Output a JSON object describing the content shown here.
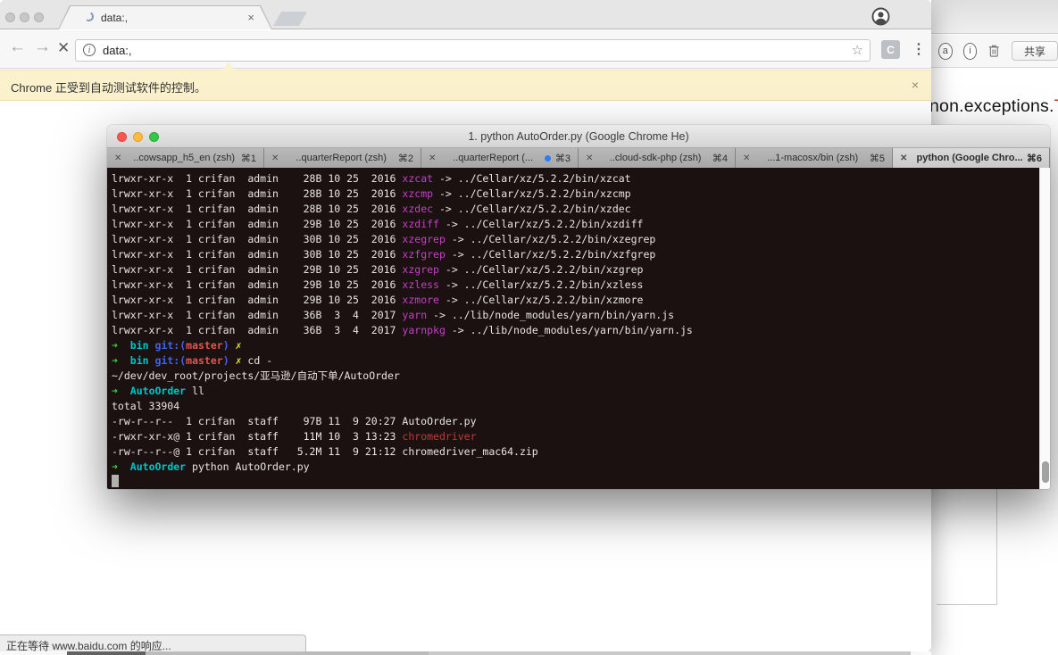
{
  "browser": {
    "tab_title": "data:,",
    "url": "data:,",
    "extension_label": "C",
    "infobar_text": "Chrome 正受到自动测试软件的控制。",
    "infobar_close": "×",
    "status_text": "正在等待 www.baidu.com 的响应...",
    "tab_close": "×",
    "back_glyph": "←",
    "forward_glyph": "→",
    "stop_glyph": "✕",
    "star_glyph": "☆",
    "menu_glyph": "⋮",
    "info_glyph": "i"
  },
  "background_window": {
    "share_button": "共享",
    "annotation_glyph": "a",
    "info_glyph": "i",
    "partial_text": "non.exceptions.",
    "partial_text_red": "Tr"
  },
  "terminal": {
    "title": "1. python AutoOrder.py (Google Chrome He)",
    "tab_close_glyph": "✕",
    "tabs": [
      {
        "label": "..cowsapp_h5_en (zsh)",
        "shortcut": "⌘1",
        "active": false,
        "dot": false
      },
      {
        "label": "..quarterReport (zsh)",
        "shortcut": "⌘2",
        "active": false,
        "dot": false
      },
      {
        "label": "..quarterReport (...",
        "shortcut": "⌘3",
        "active": false,
        "dot": true
      },
      {
        "label": "..cloud-sdk-php (zsh)",
        "shortcut": "⌘4",
        "active": false,
        "dot": false
      },
      {
        "label": "...1-macosx/bin (zsh)",
        "shortcut": "⌘5",
        "active": false,
        "dot": false
      },
      {
        "label": "python (Google Chro...",
        "shortcut": "⌘6",
        "active": true,
        "dot": false
      }
    ],
    "colors": {
      "background": "#1b1111",
      "foreground": "#e8e5e0",
      "symlink_magenta": "#c73fc7",
      "prompt_green": "#36d236",
      "prompt_cyan": "#00c5c7",
      "git_blue": "#4263f0",
      "branch_red": "#e05650",
      "file_red": "#c23936",
      "dirty_yellow": "#e7e735"
    },
    "lines": [
      [
        [
          "fg",
          "lrwxr-xr-x  1 crifan  admin    28B 10 25  2016 "
        ],
        [
          "ln",
          "xzcat"
        ],
        [
          "fg",
          " -> ../Cellar/xz/5.2.2/bin/xzcat"
        ]
      ],
      [
        [
          "fg",
          "lrwxr-xr-x  1 crifan  admin    28B 10 25  2016 "
        ],
        [
          "ln",
          "xzcmp"
        ],
        [
          "fg",
          " -> ../Cellar/xz/5.2.2/bin/xzcmp"
        ]
      ],
      [
        [
          "fg",
          "lrwxr-xr-x  1 crifan  admin    28B 10 25  2016 "
        ],
        [
          "ln",
          "xzdec"
        ],
        [
          "fg",
          " -> ../Cellar/xz/5.2.2/bin/xzdec"
        ]
      ],
      [
        [
          "fg",
          "lrwxr-xr-x  1 crifan  admin    29B 10 25  2016 "
        ],
        [
          "ln",
          "xzdiff"
        ],
        [
          "fg",
          " -> ../Cellar/xz/5.2.2/bin/xzdiff"
        ]
      ],
      [
        [
          "fg",
          "lrwxr-xr-x  1 crifan  admin    30B 10 25  2016 "
        ],
        [
          "ln",
          "xzegrep"
        ],
        [
          "fg",
          " -> ../Cellar/xz/5.2.2/bin/xzegrep"
        ]
      ],
      [
        [
          "fg",
          "lrwxr-xr-x  1 crifan  admin    30B 10 25  2016 "
        ],
        [
          "ln",
          "xzfgrep"
        ],
        [
          "fg",
          " -> ../Cellar/xz/5.2.2/bin/xzfgrep"
        ]
      ],
      [
        [
          "fg",
          "lrwxr-xr-x  1 crifan  admin    29B 10 25  2016 "
        ],
        [
          "ln",
          "xzgrep"
        ],
        [
          "fg",
          " -> ../Cellar/xz/5.2.2/bin/xzgrep"
        ]
      ],
      [
        [
          "fg",
          "lrwxr-xr-x  1 crifan  admin    29B 10 25  2016 "
        ],
        [
          "ln",
          "xzless"
        ],
        [
          "fg",
          " -> ../Cellar/xz/5.2.2/bin/xzless"
        ]
      ],
      [
        [
          "fg",
          "lrwxr-xr-x  1 crifan  admin    29B 10 25  2016 "
        ],
        [
          "ln",
          "xzmore"
        ],
        [
          "fg",
          " -> ../Cellar/xz/5.2.2/bin/xzmore"
        ]
      ],
      [
        [
          "fg",
          "lrwxr-xr-x  1 crifan  admin    36B  3  4  2017 "
        ],
        [
          "ln",
          "yarn"
        ],
        [
          "fg",
          " -> ../lib/node_modules/yarn/bin/yarn.js"
        ]
      ],
      [
        [
          "fg",
          "lrwxr-xr-x  1 crifan  admin    36B  3  4  2017 "
        ],
        [
          "ln",
          "yarnpkg"
        ],
        [
          "fg",
          " -> ../lib/node_modules/yarn/bin/yarn.js"
        ]
      ],
      [
        [
          "gr",
          "➜"
        ],
        [
          "fg",
          "  "
        ],
        [
          "cy",
          "bin"
        ],
        [
          "fg",
          " "
        ],
        [
          "bl",
          "git:("
        ],
        [
          "rd",
          "master"
        ],
        [
          "bl",
          ")"
        ],
        [
          "fg",
          " "
        ],
        [
          "yl",
          "✗"
        ]
      ],
      [
        [
          "gr",
          "➜"
        ],
        [
          "fg",
          "  "
        ],
        [
          "cy",
          "bin"
        ],
        [
          "fg",
          " "
        ],
        [
          "bl",
          "git:("
        ],
        [
          "rd",
          "master"
        ],
        [
          "bl",
          ")"
        ],
        [
          "fg",
          " "
        ],
        [
          "yl",
          "✗"
        ],
        [
          "fg",
          " cd -"
        ]
      ],
      [
        [
          "fg",
          "~/dev/dev_root/projects/亚马逊/自动下单/AutoOrder"
        ]
      ],
      [
        [
          "gr",
          "➜"
        ],
        [
          "fg",
          "  "
        ],
        [
          "cy",
          "AutoOrder"
        ],
        [
          "fg",
          " ll"
        ]
      ],
      [
        [
          "fg",
          "total 33904"
        ]
      ],
      [
        [
          "fg",
          "-rw-r--r--  1 crifan  staff    97B 11  9 20:27 AutoOrder.py"
        ]
      ],
      [
        [
          "fg",
          "-rwxr-xr-x@ 1 crifan  staff    11M 10  3 13:23 "
        ],
        [
          "rd2",
          "chromedriver"
        ]
      ],
      [
        [
          "fg",
          "-rw-r--r--@ 1 crifan  staff   5.2M 11  9 21:12 chromedriver_mac64.zip"
        ]
      ],
      [
        [
          "gr",
          "➜"
        ],
        [
          "fg",
          "  "
        ],
        [
          "cy",
          "AutoOrder"
        ],
        [
          "fg",
          " python AutoOrder.py"
        ]
      ],
      [
        [
          "cur",
          ""
        ]
      ]
    ]
  }
}
